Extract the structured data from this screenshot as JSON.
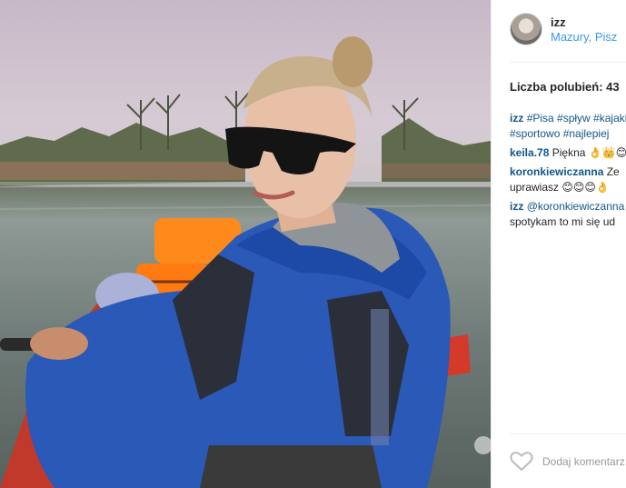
{
  "post": {
    "username": "izz",
    "location": "Mazury, Pisz",
    "likes_text": "Liczba polubień: 43",
    "add_comment_placeholder": "Dodaj komentarz..."
  },
  "caption": {
    "user": "izz",
    "line1_tags": "#Pisa #spływ #kajaki",
    "line2_tags": "#sportowo #najlepiej"
  },
  "comments": [
    {
      "user": "keila.78",
      "text": "Piękna 👌👑😊"
    },
    {
      "user": "koronkiewiczanna",
      "text": "Ze",
      "line2": "uprawiasz 😊😊😊👌"
    },
    {
      "user": "izz",
      "text": "@koronkiewiczanna",
      "line2": "spotykam to mi się ud"
    }
  ],
  "icons": {
    "heart": "heart-outline-icon",
    "avatar": "profile-avatar"
  },
  "colors": {
    "link_blue": "#3897f0",
    "username_blue": "#125688",
    "text": "#262626",
    "muted": "#999999",
    "divider": "#efefef"
  }
}
